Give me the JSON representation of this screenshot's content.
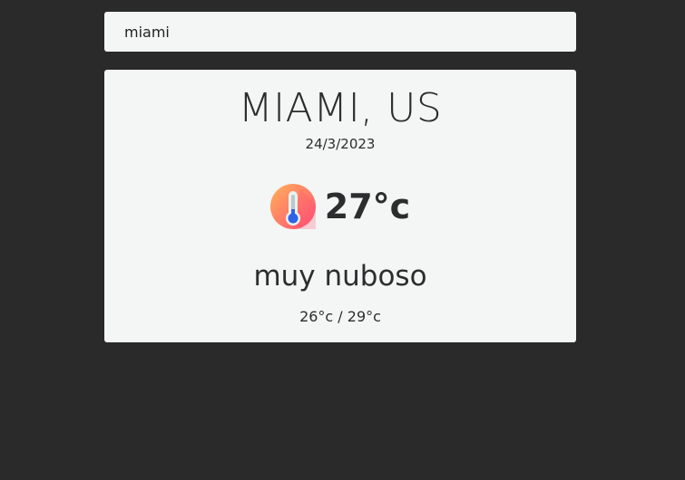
{
  "search": {
    "value": "miami"
  },
  "weather": {
    "city": "MIAMI, US",
    "date": "24/3/2023",
    "temperature": "27°c",
    "description": "muy nuboso",
    "min_max": "26°c / 29°c"
  },
  "icons": {
    "temperature_icon": "thermometer-icon"
  },
  "colors": {
    "background": "#2a2a2a",
    "card": "#f4f6f5",
    "text": "#2b2d2e",
    "icon_gradient_start": "#ffb05a",
    "icon_gradient_end": "#ff4f74",
    "thermometer_fill": "#2f62e7"
  }
}
